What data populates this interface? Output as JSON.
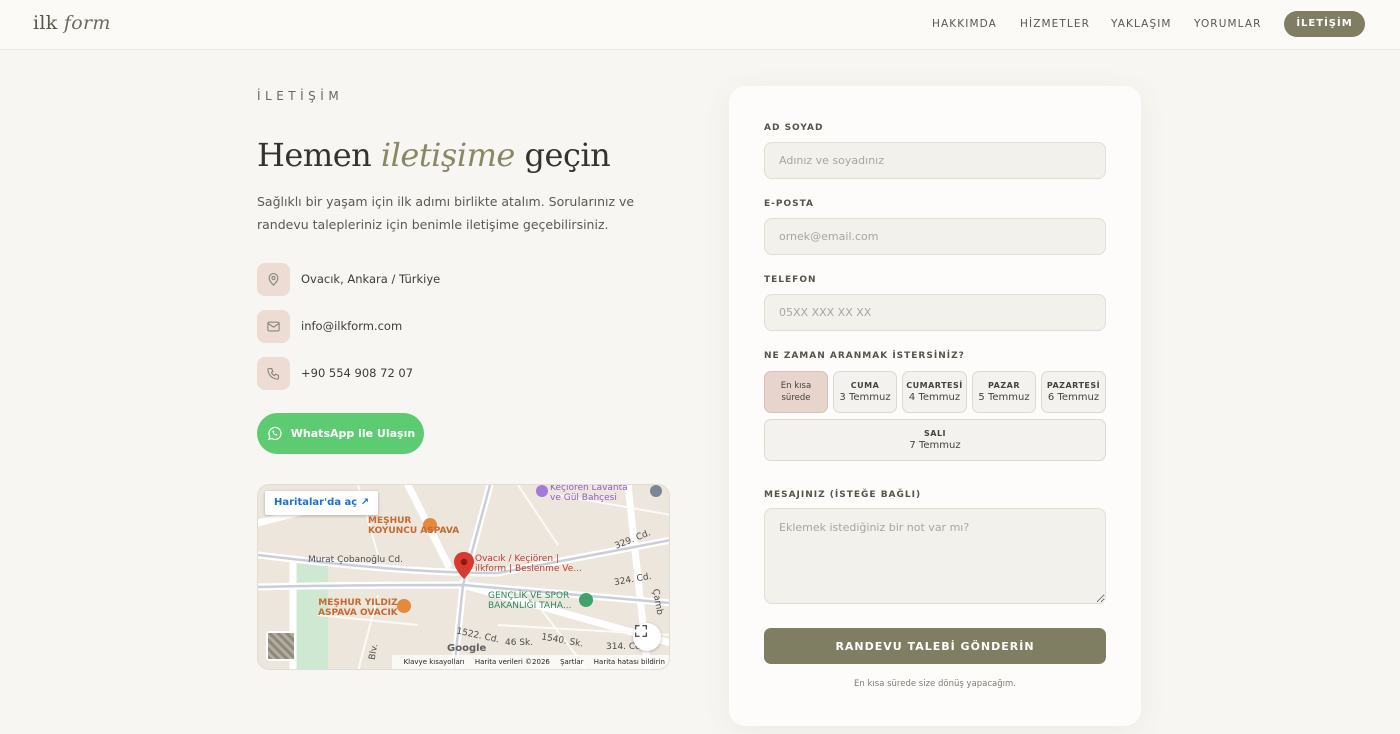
{
  "header": {
    "logo_main": "ilk",
    "logo_accent": "form",
    "nav": [
      {
        "label": "HAKKIMDA"
      },
      {
        "label": "HİZMETLER"
      },
      {
        "label": "YAKLAŞIM"
      },
      {
        "label": "YORUMLAR"
      }
    ],
    "cta_label": "İLETİŞİM"
  },
  "contact": {
    "eyebrow": "İLETİŞİM",
    "headline_pre": "Hemen",
    "headline_accent": "iletişime",
    "headline_post": "geçin",
    "lead": "Sağlıklı bir yaşam için ilk adımı birlikte atalım. Sorularınız ve randevu talepleriniz için benimle iletişime geçebilirsiniz.",
    "items": [
      {
        "icon": "map-pin-icon",
        "text": "Ovacık, Ankara / Türkiye"
      },
      {
        "icon": "mail-icon",
        "text": "info@ilkform.com"
      },
      {
        "icon": "phone-icon",
        "text": "+90 554 908 72 07"
      }
    ],
    "whatsapp_label": "WhatsApp ile Ulaşın"
  },
  "map": {
    "open_label": "Haritalar'da aç",
    "labels": {
      "poi_top": "Keçiören Lavanta",
      "poi_top2": "ve Gül Bahçesi",
      "rest1_a": "MEŞHUR",
      "rest1_b": "KOYUNCU ASPAVA",
      "street1": "Murat Çobanoğlu Cd.",
      "pin_a": "Ovacık / Keçiören |",
      "pin_b": "ilkform | Beslenme Ve...",
      "road329": "329. Cd.",
      "road324": "324. Cd.",
      "rest2_a": "MEŞHUR YILDIZ",
      "rest2_b": "ASPAVA OVACIK",
      "gov_a": "GENÇLİK VE SPOR",
      "gov_b": "BAKANLIĞI TAHA...",
      "road1522": "1522. Cd.",
      "road46": "46 Sk.",
      "road1540": "1540. Sk.",
      "road314": "314. Cd.",
      "road_camb": "Çamb",
      "road_blv": "Blv."
    },
    "google": "Google",
    "footer": [
      "Klavye kısayolları",
      "Harita verileri ©2026",
      "Şartlar",
      "Harita hatası bildirin"
    ]
  },
  "form": {
    "name_label": "AD SOYAD",
    "name_placeholder": "Adınız ve soyadınız",
    "email_label": "E-POSTA",
    "email_placeholder": "ornek@email.com",
    "phone_label": "TELEFON",
    "phone_placeholder": "05XX XXX XX XX",
    "when_label": "NE ZAMAN ARANMAK İSTERSİNİZ?",
    "days": [
      {
        "top": "En kısa",
        "bottom": "sürede",
        "active": true
      },
      {
        "top": "CUMA",
        "bottom": "3 Temmuz"
      },
      {
        "top": "CUMARTESİ",
        "bottom": "4 Temmuz"
      },
      {
        "top": "PAZAR",
        "bottom": "5 Temmuz"
      },
      {
        "top": "PAZARTESİ",
        "bottom": "6 Temmuz"
      },
      {
        "top": "SALI",
        "bottom": "7 Temmuz"
      }
    ],
    "message_label": "MESAJINIZ (İSTEĞE BAĞLI)",
    "message_placeholder": "Eklemek istediğiniz bir not var mı?",
    "submit_label": "RANDEVU TALEBİ GÖNDERİN",
    "note": "En kısa sürede size dönüş yapacağım."
  },
  "colors": {
    "accent": "#7f7d62",
    "whatsapp": "#5dcb72",
    "icon_bg": "#ecdcd3"
  }
}
